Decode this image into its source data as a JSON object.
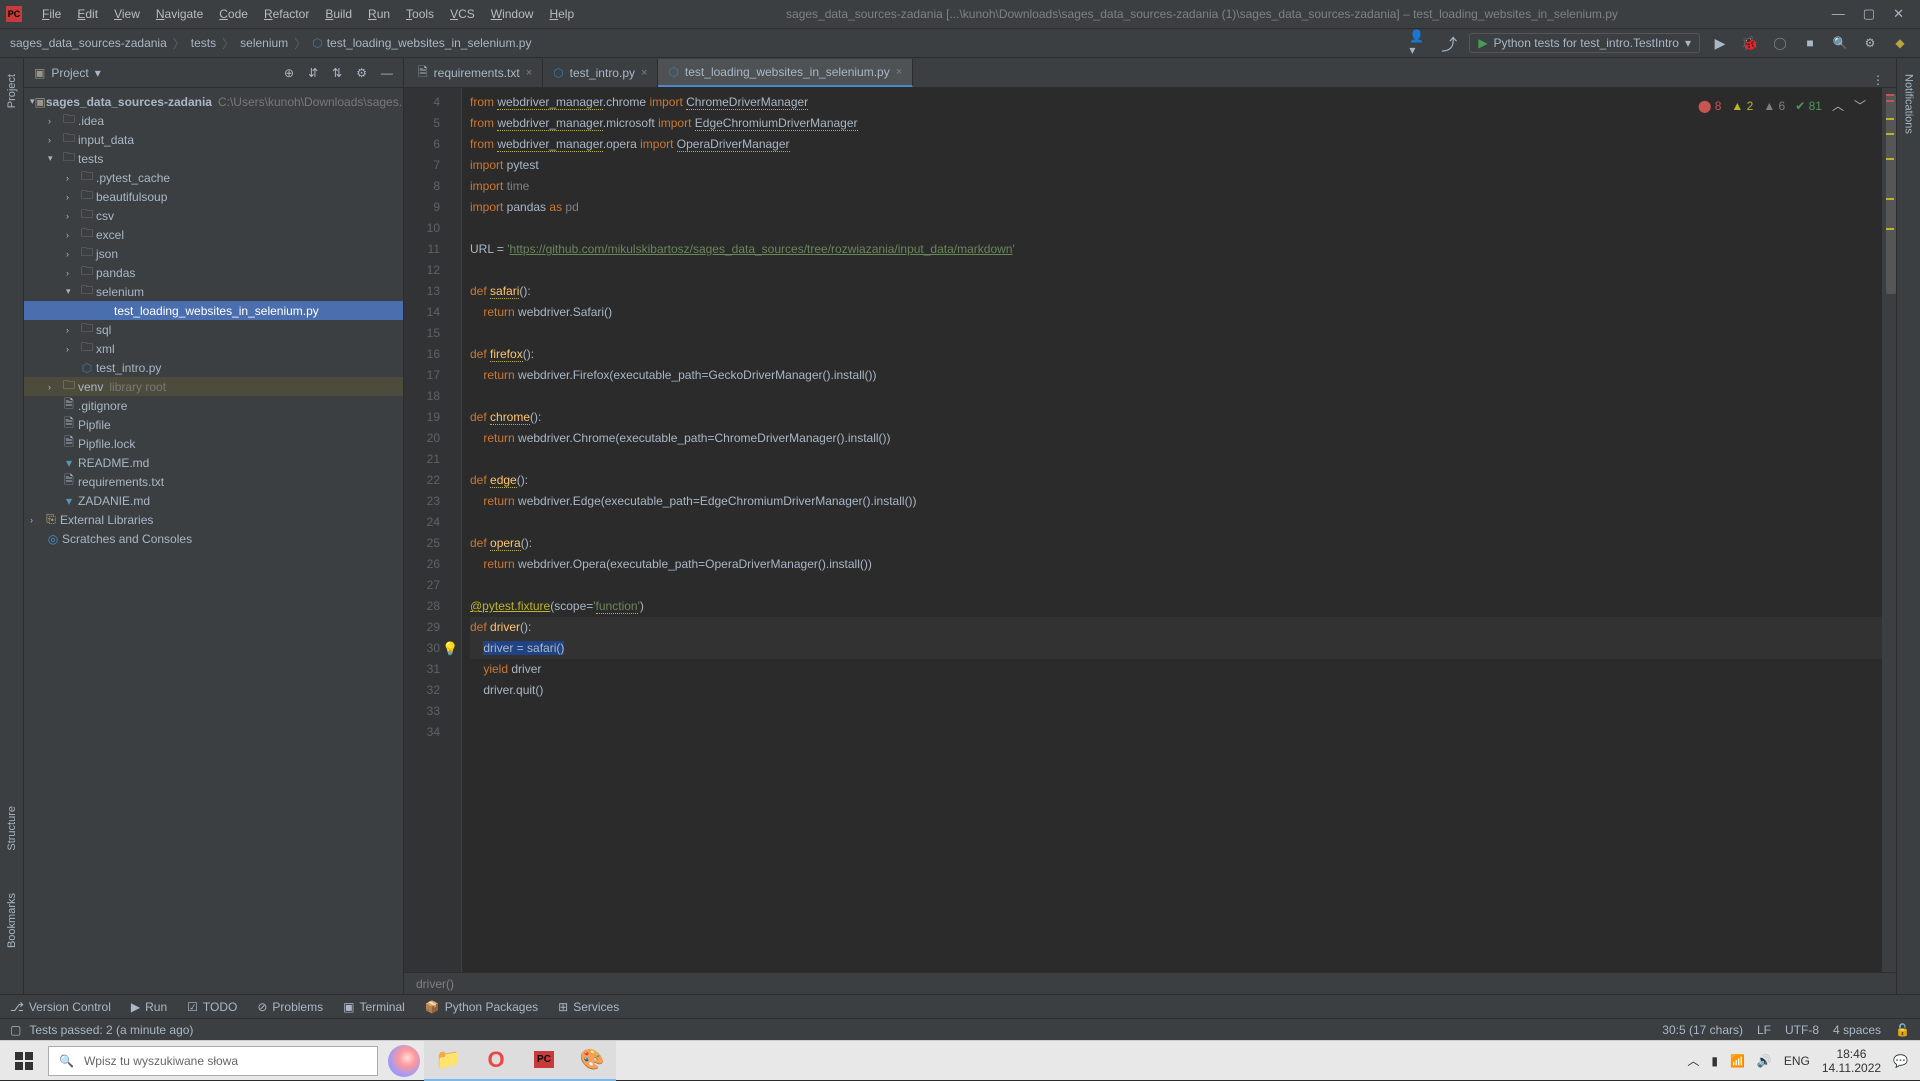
{
  "menu": [
    "File",
    "Edit",
    "View",
    "Navigate",
    "Code",
    "Refactor",
    "Build",
    "Run",
    "Tools",
    "VCS",
    "Window",
    "Help"
  ],
  "window_title": "sages_data_sources-zadania [...\\kunoh\\Downloads\\sages_data_sources-zadania (1)\\sages_data_sources-zadania] – test_loading_websites_in_selenium.py",
  "breadcrumbs": [
    "sages_data_sources-zadania",
    "tests",
    "selenium",
    "test_loading_websites_in_selenium.py"
  ],
  "run_config": "Python tests for test_intro.TestIntro",
  "project_panel": {
    "title": "Project"
  },
  "tree": {
    "root": "sages_data_sources-zadania",
    "root_hint": "C:\\Users\\kunoh\\Downloads\\sages...",
    "items": [
      {
        "depth": 1,
        "chev": ">",
        "icon": "folder",
        "label": ".idea"
      },
      {
        "depth": 1,
        "chev": ">",
        "icon": "folder",
        "label": "input_data"
      },
      {
        "depth": 1,
        "chev": "v",
        "icon": "folder",
        "label": "tests"
      },
      {
        "depth": 2,
        "chev": ">",
        "icon": "folder",
        "label": ".pytest_cache"
      },
      {
        "depth": 2,
        "chev": ">",
        "icon": "folder",
        "label": "beautifulsoup"
      },
      {
        "depth": 2,
        "chev": ">",
        "icon": "folder",
        "label": "csv"
      },
      {
        "depth": 2,
        "chev": ">",
        "icon": "folder",
        "label": "excel"
      },
      {
        "depth": 2,
        "chev": ">",
        "icon": "folder",
        "label": "json"
      },
      {
        "depth": 2,
        "chev": ">",
        "icon": "folder",
        "label": "pandas"
      },
      {
        "depth": 2,
        "chev": "v",
        "icon": "folder",
        "label": "selenium"
      },
      {
        "depth": 3,
        "chev": "",
        "icon": "py",
        "label": "test_loading_websites_in_selenium.py",
        "selected": true
      },
      {
        "depth": 2,
        "chev": ">",
        "icon": "folder",
        "label": "sql"
      },
      {
        "depth": 2,
        "chev": ">",
        "icon": "folder",
        "label": "xml"
      },
      {
        "depth": 2,
        "chev": "",
        "icon": "py",
        "label": "test_intro.py"
      },
      {
        "depth": 1,
        "chev": ">",
        "icon": "lib",
        "label": "venv",
        "hint": "library root",
        "venv": true
      },
      {
        "depth": 1,
        "chev": "",
        "icon": "file",
        "label": ".gitignore"
      },
      {
        "depth": 1,
        "chev": "",
        "icon": "file",
        "label": "Pipfile"
      },
      {
        "depth": 1,
        "chev": "",
        "icon": "file",
        "label": "Pipfile.lock"
      },
      {
        "depth": 1,
        "chev": "",
        "icon": "md",
        "label": "README.md"
      },
      {
        "depth": 1,
        "chev": "",
        "icon": "file",
        "label": "requirements.txt"
      },
      {
        "depth": 1,
        "chev": "",
        "icon": "md",
        "label": "ZADANIE.md"
      }
    ],
    "ext_lib": "External Libraries",
    "scratches": "Scratches and Consoles"
  },
  "tabs": [
    {
      "label": "requirements.txt",
      "icon": "file"
    },
    {
      "label": "test_intro.py",
      "icon": "py"
    },
    {
      "label": "test_loading_websites_in_selenium.py",
      "icon": "py",
      "active": true
    }
  ],
  "inspections": {
    "errors": "8",
    "warnings": "2",
    "weak": "6",
    "ok": "81"
  },
  "code": {
    "first_line_no": 4,
    "lines": [
      {
        "html": "<span class='kw'>from</span> <span class='warn-underline'>webdriver_manager</span>.chrome <span class='kw'>import</span> <span class='warn-underline'>ChromeDriverManager</span>"
      },
      {
        "html": "<span class='kw'>from</span> <span class='warn-underline'>webdriver_manager</span>.microsoft <span class='kw'>import</span> <span class='warn-underline'>EdgeChromiumDriverManager</span>"
      },
      {
        "html": "<span class='kw'>from</span> <span class='warn-underline'>webdriver_manager</span>.opera <span class='kw'>import</span> <span class='warn-underline'>OperaDriverManager</span>"
      },
      {
        "html": "<span class='kw'>import</span> pytest"
      },
      {
        "html": "<span class='kw'>import</span> <span class='unused'>time</span>"
      },
      {
        "html": "<span class='kw'>import</span> pandas <span class='kw'>as</span> <span class='unused'>pd</span>"
      },
      {
        "html": ""
      },
      {
        "html": "URL = <span class='str'>'<span class='lnk'>https://github.com/mikulskibartosz/sages_data_sources/tree/rozwiazania/input_data/markdown</span>'</span>"
      },
      {
        "html": ""
      },
      {
        "html": "<span class='kw'>def </span><span class='fn warn-underline'>safari</span>():"
      },
      {
        "html": "    <span class='kw'>return</span> webdriver.Safari()"
      },
      {
        "html": ""
      },
      {
        "html": "<span class='kw'>def </span><span class='fn warn-underline'>firefox</span>():"
      },
      {
        "html": "    <span class='kw'>return</span> webdriver.Firefox(executable_path=GeckoDriverManager().install())"
      },
      {
        "html": ""
      },
      {
        "html": "<span class='kw'>def </span><span class='fn warn-underline'>chrome</span>():"
      },
      {
        "html": "    <span class='kw'>return</span> webdriver.Chrome(executable_path=ChromeDriverManager().install())"
      },
      {
        "html": ""
      },
      {
        "html": "<span class='kw'>def </span><span class='fn warn-underline'>edge</span>():"
      },
      {
        "html": "    <span class='kw'>return</span> webdriver.Edge(executable_path=EdgeChromiumDriverManager().install())"
      },
      {
        "html": ""
      },
      {
        "html": "<span class='kw'>def </span><span class='fn warn-underline'>opera</span>():"
      },
      {
        "html": "    <span class='kw'>return</span> webdriver.Opera(executable_path=OperaDriverManager().install())"
      },
      {
        "html": ""
      },
      {
        "html": "<span class='decor'>@pytest.fixture</span>(scope=<span class='str'>'<span class='warn-underline'>function</span>'</span>)"
      },
      {
        "html": "<span class='kw'>def </span><span class='fn'>driver</span>():",
        "hl": true
      },
      {
        "html": "    <span class='selection'>driver = safari()</span>",
        "hl": true,
        "bulb": true
      },
      {
        "html": "    <span class='kw'>yield</span> driver"
      },
      {
        "html": "    driver.quit()"
      },
      {
        "html": ""
      },
      {
        "html": ""
      }
    ]
  },
  "context_bar": "driver()",
  "tool_tabs": [
    "Version Control",
    "Run",
    "TODO",
    "Problems",
    "Terminal",
    "Python Packages",
    "Services"
  ],
  "status": {
    "left": "Tests passed: 2 (a minute ago)",
    "caret": "30:5 (17 chars)",
    "eol": "LF",
    "enc": "UTF-8",
    "indent": "4 spaces"
  },
  "taskbar": {
    "search_placeholder": "Wpisz tu wyszukiwane słowa",
    "lang": "ENG",
    "time": "18:46",
    "date": "14.11.2022"
  },
  "left_tabs": [
    "Project",
    "Structure",
    "Bookmarks"
  ],
  "right_tabs": [
    "Notifications"
  ]
}
